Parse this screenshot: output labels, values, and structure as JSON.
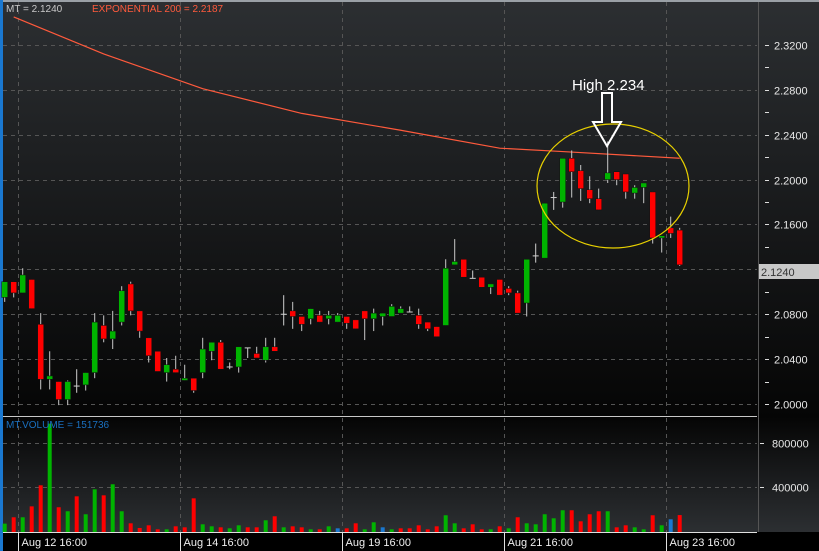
{
  "legend": {
    "symbol_label": "MT = 2.1240",
    "ema_label": "EXPONENTIAL 200 = 2.2187",
    "volume_label": "MT.VOLUME = 151736"
  },
  "last_price_label": "2.1240",
  "annotation": {
    "text": "High 2.234"
  },
  "colors": {
    "up": "#00b400",
    "down": "#ff0000",
    "neutral": "#1a78d0",
    "ema": "#ff5a3c",
    "ellipse": "#e8d000"
  },
  "chart_data": {
    "type": "candlestick",
    "title": "MT",
    "price_axis": {
      "ylim": [
        2.0,
        2.32
      ],
      "ticks": [
        "2.0000",
        "2.0400",
        "2.0800",
        "2.1200",
        "2.1600",
        "2.2000",
        "2.2400",
        "2.2800",
        "2.3200"
      ],
      "tick_values": [
        2.0,
        2.04,
        2.08,
        2.12,
        2.16,
        2.2,
        2.24,
        2.28,
        2.32
      ]
    },
    "volume_axis": {
      "ticks": [
        "400000",
        "800000"
      ],
      "tick_values": [
        400000,
        800000
      ]
    },
    "x_labels": [
      {
        "index": 2,
        "label": "Aug 12 16:00"
      },
      {
        "index": 20,
        "label": "Aug 14 16:00"
      },
      {
        "index": 38,
        "label": "Aug 19 16:00"
      },
      {
        "index": 56,
        "label": "Aug 21 16:00"
      },
      {
        "index": 74,
        "label": "Aug 23 16:00"
      }
    ],
    "ohlc": [
      [
        2.095,
        2.109,
        2.091,
        2.109
      ],
      [
        2.109,
        2.109,
        2.095,
        2.099
      ],
      [
        2.099,
        2.121,
        2.099,
        2.115
      ],
      [
        2.111,
        2.111,
        2.085,
        2.085
      ],
      [
        2.071,
        2.081,
        2.013,
        2.022
      ],
      [
        2.022,
        2.047,
        2.013,
        2.025
      ],
      [
        2.02,
        2.02,
        1.999,
        2.004
      ],
      [
        2.004,
        2.021,
        1.999,
        2.02
      ],
      [
        2.016,
        2.031,
        2.01,
        2.016
      ],
      [
        2.017,
        2.028,
        2.012,
        2.028
      ],
      [
        2.028,
        2.081,
        2.023,
        2.073
      ],
      [
        2.07,
        2.079,
        2.055,
        2.058
      ],
      [
        2.058,
        2.083,
        2.049,
        2.065
      ],
      [
        2.073,
        2.105,
        2.07,
        2.101
      ],
      [
        2.107,
        2.109,
        2.079,
        2.083
      ],
      [
        2.083,
        2.083,
        2.059,
        2.065
      ],
      [
        2.059,
        2.059,
        2.037,
        2.043
      ],
      [
        2.047,
        2.047,
        2.029,
        2.029
      ],
      [
        2.028,
        2.041,
        2.02,
        2.035
      ],
      [
        2.031,
        2.043,
        2.028,
        2.028
      ],
      [
        2.021,
        2.035,
        2.021,
        2.023
      ],
      [
        2.023,
        2.023,
        2.01,
        2.012
      ],
      [
        2.028,
        2.059,
        2.023,
        2.049
      ],
      [
        2.047,
        2.055,
        2.039,
        2.055
      ],
      [
        2.055,
        2.057,
        2.031,
        2.031
      ],
      [
        2.033,
        2.037,
        2.031,
        2.033
      ],
      [
        2.033,
        2.051,
        2.028,
        2.051
      ],
      [
        2.05,
        2.05,
        2.041,
        2.05
      ],
      [
        2.045,
        2.051,
        2.041,
        2.041
      ],
      [
        2.039,
        2.059,
        2.037,
        2.051
      ],
      [
        2.051,
        2.059,
        2.047,
        2.047
      ],
      [
        2.08,
        2.097,
        2.07,
        2.08
      ],
      [
        2.083,
        2.091,
        2.067,
        2.078
      ],
      [
        2.078,
        2.078,
        2.065,
        2.071
      ],
      [
        2.076,
        2.085,
        2.071,
        2.085
      ],
      [
        2.079,
        2.083,
        2.073,
        2.073
      ],
      [
        2.076,
        2.083,
        2.071,
        2.079
      ],
      [
        2.073,
        2.081,
        2.073,
        2.079
      ],
      [
        2.078,
        2.078,
        2.067,
        2.072
      ],
      [
        2.075,
        2.075,
        2.067,
        2.067
      ],
      [
        2.083,
        2.083,
        2.057,
        2.076
      ],
      [
        2.076,
        2.085,
        2.065,
        2.081
      ],
      [
        2.078,
        2.081,
        2.07,
        2.081
      ],
      [
        2.078,
        2.089,
        2.078,
        2.087
      ],
      [
        2.081,
        2.087,
        2.081,
        2.085
      ],
      [
        2.082,
        2.087,
        2.082,
        2.082
      ],
      [
        2.079,
        2.085,
        2.067,
        2.071
      ],
      [
        2.073,
        2.073,
        2.065,
        2.067
      ],
      [
        2.069,
        2.069,
        2.06,
        2.06
      ],
      [
        2.07,
        2.129,
        2.07,
        2.121
      ],
      [
        2.124,
        2.147,
        2.124,
        2.127
      ],
      [
        2.129,
        2.129,
        2.113,
        2.113
      ],
      [
        2.112,
        2.119,
        2.112,
        2.112
      ],
      [
        2.113,
        2.113,
        2.104,
        2.104
      ],
      [
        2.104,
        2.107,
        2.098,
        2.107
      ],
      [
        2.111,
        2.111,
        2.097,
        2.097
      ],
      [
        2.103,
        2.105,
        2.097,
        2.099
      ],
      [
        2.099,
        2.101,
        2.081,
        2.081
      ],
      [
        2.09,
        2.129,
        2.078,
        2.129
      ],
      [
        2.132,
        2.143,
        2.126,
        2.132
      ],
      [
        2.13,
        2.179,
        2.13,
        2.179
      ],
      [
        2.184,
        2.189,
        2.173,
        2.184
      ],
      [
        2.18,
        2.219,
        2.175,
        2.219
      ],
      [
        2.219,
        2.226,
        2.184,
        2.207
      ],
      [
        2.208,
        2.213,
        2.181,
        2.192
      ],
      [
        2.191,
        2.203,
        2.179,
        2.183
      ],
      [
        2.183,
        2.192,
        2.173,
        2.173
      ],
      [
        2.2,
        2.234,
        2.197,
        2.206
      ],
      [
        2.207,
        2.207,
        2.195,
        2.2
      ],
      [
        2.205,
        2.205,
        2.183,
        2.189
      ],
      [
        2.188,
        2.195,
        2.183,
        2.193
      ],
      [
        2.193,
        2.197,
        2.179,
        2.197
      ],
      [
        2.189,
        2.189,
        2.143,
        2.148
      ],
      [
        2.148,
        2.15,
        2.135,
        2.15
      ],
      [
        2.157,
        2.167,
        2.148,
        2.152
      ],
      [
        2.155,
        2.157,
        2.123,
        2.124
      ]
    ],
    "volume": [
      75000,
      132000,
      132000,
      230000,
      419000,
      972000,
      222000,
      186000,
      320000,
      159000,
      383000,
      329000,
      428000,
      186000,
      78000,
      36000,
      60000,
      24000,
      24000,
      51000,
      42000,
      302000,
      69000,
      51000,
      42000,
      33000,
      60000,
      42000,
      42000,
      105000,
      141000,
      42000,
      51000,
      42000,
      24000,
      24000,
      51000,
      33000,
      33000,
      78000,
      24000,
      87000,
      42000,
      24000,
      33000,
      33000,
      60000,
      24000,
      51000,
      150000,
      78000,
      33000,
      69000,
      24000,
      24000,
      51000,
      33000,
      132000,
      78000,
      69000,
      159000,
      123000,
      195000,
      195000,
      96000,
      159000,
      186000,
      186000,
      42000,
      60000,
      42000,
      24000,
      150000,
      60000,
      114000,
      151736
    ],
    "volume_dir": [
      "g",
      "r",
      "g",
      "r",
      "r",
      "g",
      "r",
      "g",
      "r",
      "g",
      "g",
      "r",
      "g",
      "g",
      "r",
      "r",
      "r",
      "r",
      "g",
      "r",
      "r",
      "r",
      "g",
      "g",
      "r",
      "g",
      "g",
      "r",
      "r",
      "g",
      "r",
      "g",
      "r",
      "r",
      "g",
      "r",
      "g",
      "b",
      "r",
      "r",
      "g",
      "g",
      "b",
      "g",
      "r",
      "r",
      "r",
      "r",
      "r",
      "g",
      "g",
      "r",
      "r",
      "r",
      "g",
      "r",
      "g",
      "r",
      "g",
      "g",
      "g",
      "g",
      "g",
      "r",
      "r",
      "r",
      "r",
      "g",
      "r",
      "r",
      "g",
      "g",
      "r",
      "g",
      "b",
      "r"
    ],
    "ema200": [
      [
        1,
        2.345
      ],
      [
        11,
        2.312
      ],
      [
        22,
        2.281
      ],
      [
        33,
        2.259
      ],
      [
        44,
        2.244
      ],
      [
        55,
        2.228
      ],
      [
        62,
        2.225
      ],
      [
        75,
        2.219
      ]
    ],
    "annotation": {
      "text": "High 2.234",
      "candle_index": 67,
      "value": 2.234
    }
  }
}
